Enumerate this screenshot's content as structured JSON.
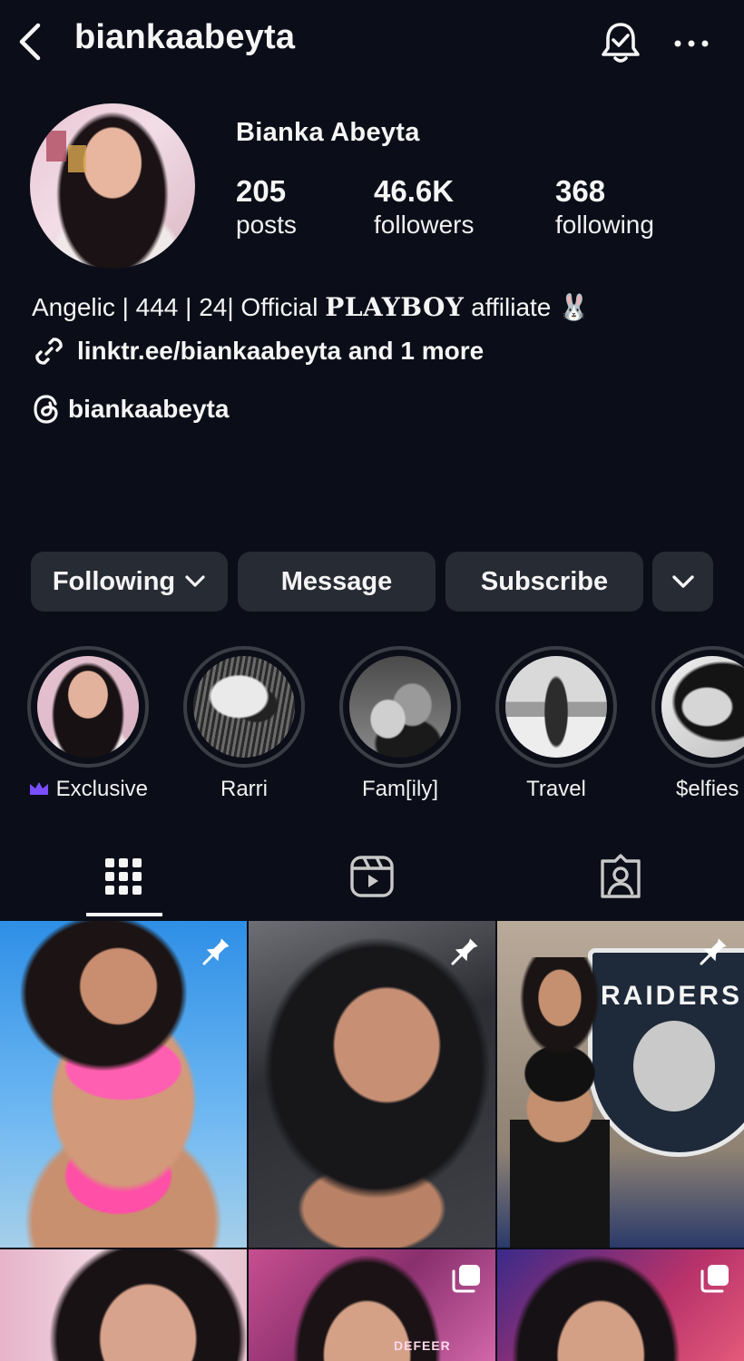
{
  "header": {
    "username": "biankaabeyta",
    "icons": [
      "back-icon",
      "notification-bell-icon",
      "more-icon"
    ]
  },
  "profile": {
    "display_name": "Bianka Abeyta",
    "stats": {
      "posts": {
        "value": "205",
        "label": "posts"
      },
      "followers": {
        "value": "46.6K",
        "label": "followers"
      },
      "following": {
        "value": "368",
        "label": "following"
      }
    },
    "bio": {
      "prefix": "Angelic | 444 | 24| Official ",
      "brand": "PLAYBOY",
      "suffix": " affiliate ",
      "emoji": "🐰"
    },
    "link": "linktr.ee/biankaabeyta and 1 more",
    "threads": "biankaabeyta"
  },
  "actions": {
    "following": "Following",
    "message": "Message",
    "subscribe": "Subscribe"
  },
  "highlights": [
    {
      "label": "Exclusive",
      "badge": "crown-icon",
      "badge_color": "#7a4dff"
    },
    {
      "label": "Rarri"
    },
    {
      "label": "Fam[ily]"
    },
    {
      "label": "Travel"
    },
    {
      "label": "$elfies"
    }
  ],
  "tabs": [
    "grid-icon",
    "reels-icon",
    "tagged-icon"
  ],
  "grid": {
    "overlay_texts": [
      "RAIDERS",
      "DEFEER"
    ]
  },
  "colors": {
    "background": "#0b0e18",
    "button": "#272b33",
    "text": "#f5f5f5"
  }
}
